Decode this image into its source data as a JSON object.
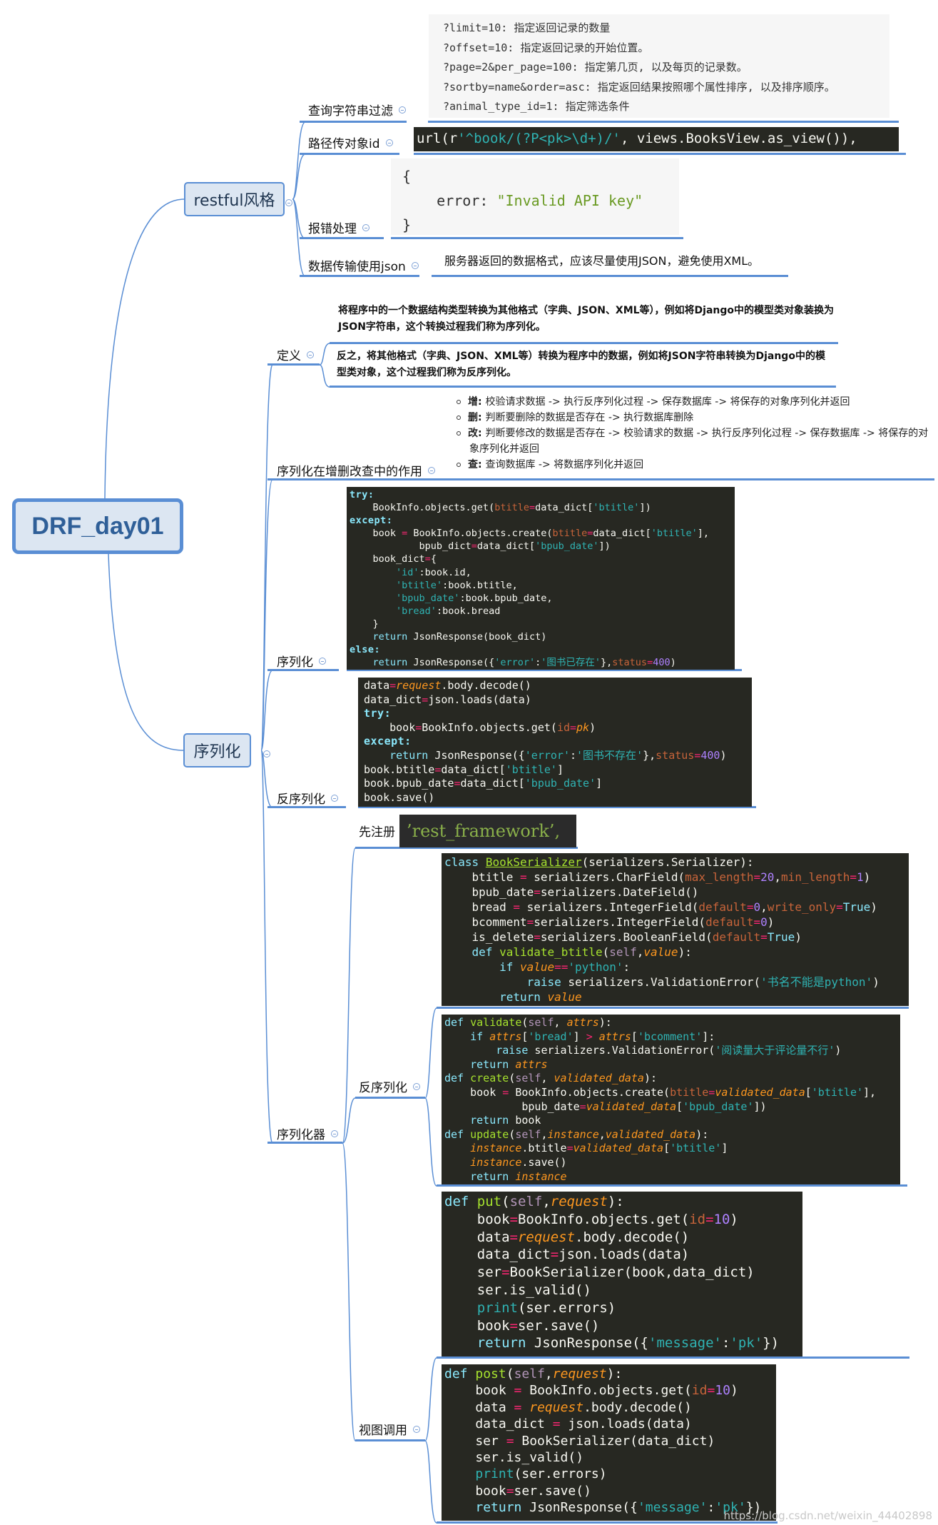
{
  "root": {
    "title": "DRF_day01"
  },
  "colors": {
    "line": "#5a8ed4",
    "node_fill": "#dce6f2",
    "code_bg": "#272822"
  },
  "restful": {
    "title": "restful风格",
    "query": {
      "label": "查询字符串过滤",
      "lines": [
        "?limit=10: 指定返回记录的数量",
        "?offset=10: 指定返回记录的开始位置。",
        "?page=2&per_page=100: 指定第几页, 以及每页的记录数。",
        "?sortby=name&order=asc: 指定返回结果按照哪个属性排序, 以及排序顺序。",
        "?animal_type_id=1: 指定筛选条件"
      ]
    },
    "path": {
      "label": "路径传对象id",
      "code": [
        "url(r'^book/(?P<pk>\\d+)/', views.BooksView.as_view()),"
      ]
    },
    "error": {
      "label": "报错处理",
      "lines": [
        "{",
        "    error: \"Invalid API key\"",
        "}"
      ]
    },
    "json": {
      "label": "数据传输使用json",
      "text": "服务器返回的数据格式，应该尽量使用JSON，避免使用XML。"
    }
  },
  "serialize": {
    "title": "序列化",
    "definition": {
      "label": "定义",
      "texts": [
        "将程序中的一个数据结构类型转换为其他格式（字典、JSON、XML等），例如将Django中的模型类对象装换为JSON字符串，这个转换过程我们称为序列化。",
        "反之，将其他格式（字典、JSON、XML等）转换为程序中的数据，例如将JSON字符串转换为Django中的模型类对象，这个过程我们称为反序列化。"
      ]
    },
    "crud": {
      "label": "序列化在增删改查中的作用",
      "items": [
        {
          "key": "增",
          "text": "校验请求数据 -> 执行反序列化过程 -> 保存数据库 -> 将保存的对象序列化并返回"
        },
        {
          "key": "删",
          "text": "判断要删除的数据是否存在 -> 执行数据库删除"
        },
        {
          "key": "改",
          "text": "判断要修改的数据是否存在 -> 校验请求的数据 -> 执行反序列化过程 -> 保存数据库 -> 将保存的对象序列化并返回"
        },
        {
          "key": "查",
          "text": "查询数据库 -> 将数据序列化并返回"
        }
      ]
    },
    "ser": {
      "label": "序列化",
      "code": [
        "try:",
        "    BookInfo.objects.get(btitle=data_dict['btitle'])",
        "except:",
        "    book = BookInfo.objects.create(btitle=data_dict['btitle'],",
        "            bpub_dict=data_dict['bpub_date'])",
        "    book_dict={",
        "        'id':book.id,",
        "        'btitle':book.btitle,",
        "        'bpub_date':book.bpub_date,",
        "        'bread':book.bread",
        "    }",
        "    return JsonResponse(book_dict)",
        "else:",
        "    return JsonResponse({'error':'图书已存在'},status=400)"
      ]
    },
    "deser": {
      "label": "反序列化",
      "code": [
        "data=request.body.decode()",
        "data_dict=json.loads(data)",
        "try:",
        "    book=BookInfo.objects.get(id=pk)",
        "except:",
        "    return JsonResponse({'error':'图书不存在'},status=400)",
        "book.btitle=data_dict['btitle']",
        "book.bpub_date=data_dict['bpub_date']",
        "book.save()"
      ]
    },
    "serializer": {
      "label": "序列化器",
      "register": {
        "label": "先注册",
        "code": "’rest_framework’,"
      },
      "deser": {
        "label": "反序列化",
        "code_a": [
          "class BookSerializer(serializers.Serializer):",
          "    btitle = serializers.CharField(max_length=20,min_length=1)",
          "    bpub_date=serializers.DateField()",
          "    bread = serializers.IntegerField(default=0,write_only=True)",
          "    bcomment=serializers.IntegerField(default=0)",
          "    is_delete=serializers.BooleanField(default=True)",
          "    def validate_btitle(self,value):",
          "        if value=='python':",
          "            raise serializers.ValidationError('书名不能是python')",
          "        return value"
        ],
        "code_b": [
          "def validate(self, attrs):",
          "    if attrs['bread'] > attrs['bcomment']:",
          "        raise serializers.ValidationError('阅读量大于评论量不行')",
          "    return attrs",
          "def create(self, validated_data):",
          "    book = BookInfo.objects.create(btitle=validated_data['btitle'],",
          "            bpub_date=validated_data['bpub_date'])",
          "    return book",
          "def update(self,instance,validated_data):",
          "    instance.btitle=validated_data['btitle']",
          "    instance.save()",
          "    return instance"
        ]
      },
      "view": {
        "label": "视图调用",
        "code_put": [
          "def put(self,request):",
          "    book=BookInfo.objects.get(id=10)",
          "    data=request.body.decode()",
          "    data_dict=json.loads(data)",
          "    ser=BookSerializer(book,data_dict)",
          "    ser.is_valid()",
          "    print(ser.errors)",
          "    book=ser.save()",
          "    return JsonResponse({'message':'pk'})"
        ],
        "code_post": [
          "def post(self,request):",
          "    book = BookInfo.objects.get(id=10)",
          "    data = request.body.decode()",
          "    data_dict = json.loads(data)",
          "    ser = BookSerializer(data_dict)",
          "    ser.is_valid()",
          "    print(ser.errors)",
          "    book=ser.save()",
          "    return JsonResponse({'message':'pk'})"
        ]
      }
    }
  },
  "watermark": "https://blog.csdn.net/weixin_44402898"
}
